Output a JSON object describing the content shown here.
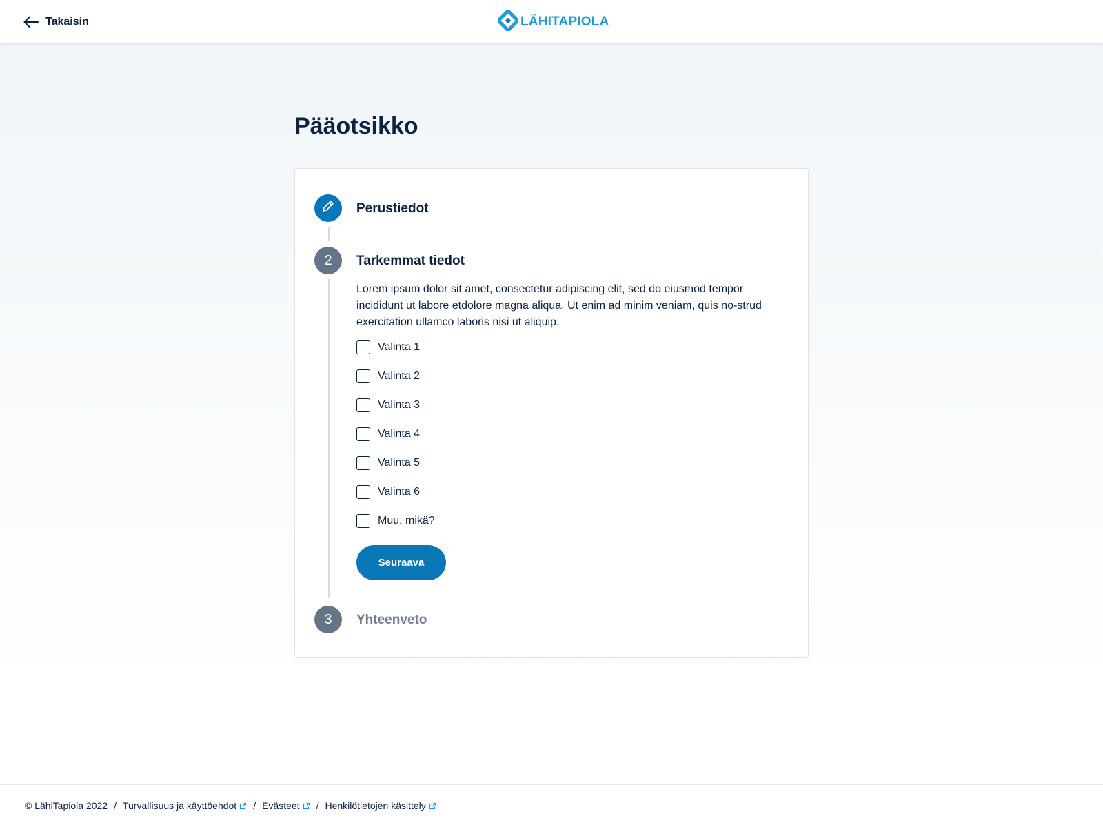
{
  "header": {
    "back_label": "Takaisin",
    "logo_text": "LÄHITAPIOLA",
    "brand_color": "#1f9bd6"
  },
  "main": {
    "title": "Pääotsikko",
    "accent_color": "#0a78b8",
    "steps": [
      {
        "number": "",
        "icon": "pencil-icon",
        "title": "Perustiedot",
        "state": "active"
      },
      {
        "number": "2",
        "title": "Tarkemmat tiedot",
        "state": "current",
        "description": "Lorem ipsum dolor sit amet, consectetur adipiscing elit, sed do eiusmod tempor incididunt ut labore etdolore magna aliqua. Ut enim ad minim veniam, quis no-strud exercitation ullamco laboris nisi ut aliquip.",
        "options": [
          "Valinta 1",
          "Valinta 2",
          "Valinta 3",
          "Valinta 4",
          "Valinta 5",
          "Valinta 6",
          "Muu, mikä?"
        ],
        "next_label": "Seuraava"
      },
      {
        "number": "3",
        "title": "Yhteenveto",
        "state": "pending"
      }
    ]
  },
  "footer": {
    "copyright": "© LähiTapiola 2022",
    "separator": "/",
    "links": [
      "Turvallisuus ja käyttöehdot",
      "Evästeet",
      "Henkilötietojen käsittely"
    ],
    "link_icon": "external-link-icon"
  }
}
